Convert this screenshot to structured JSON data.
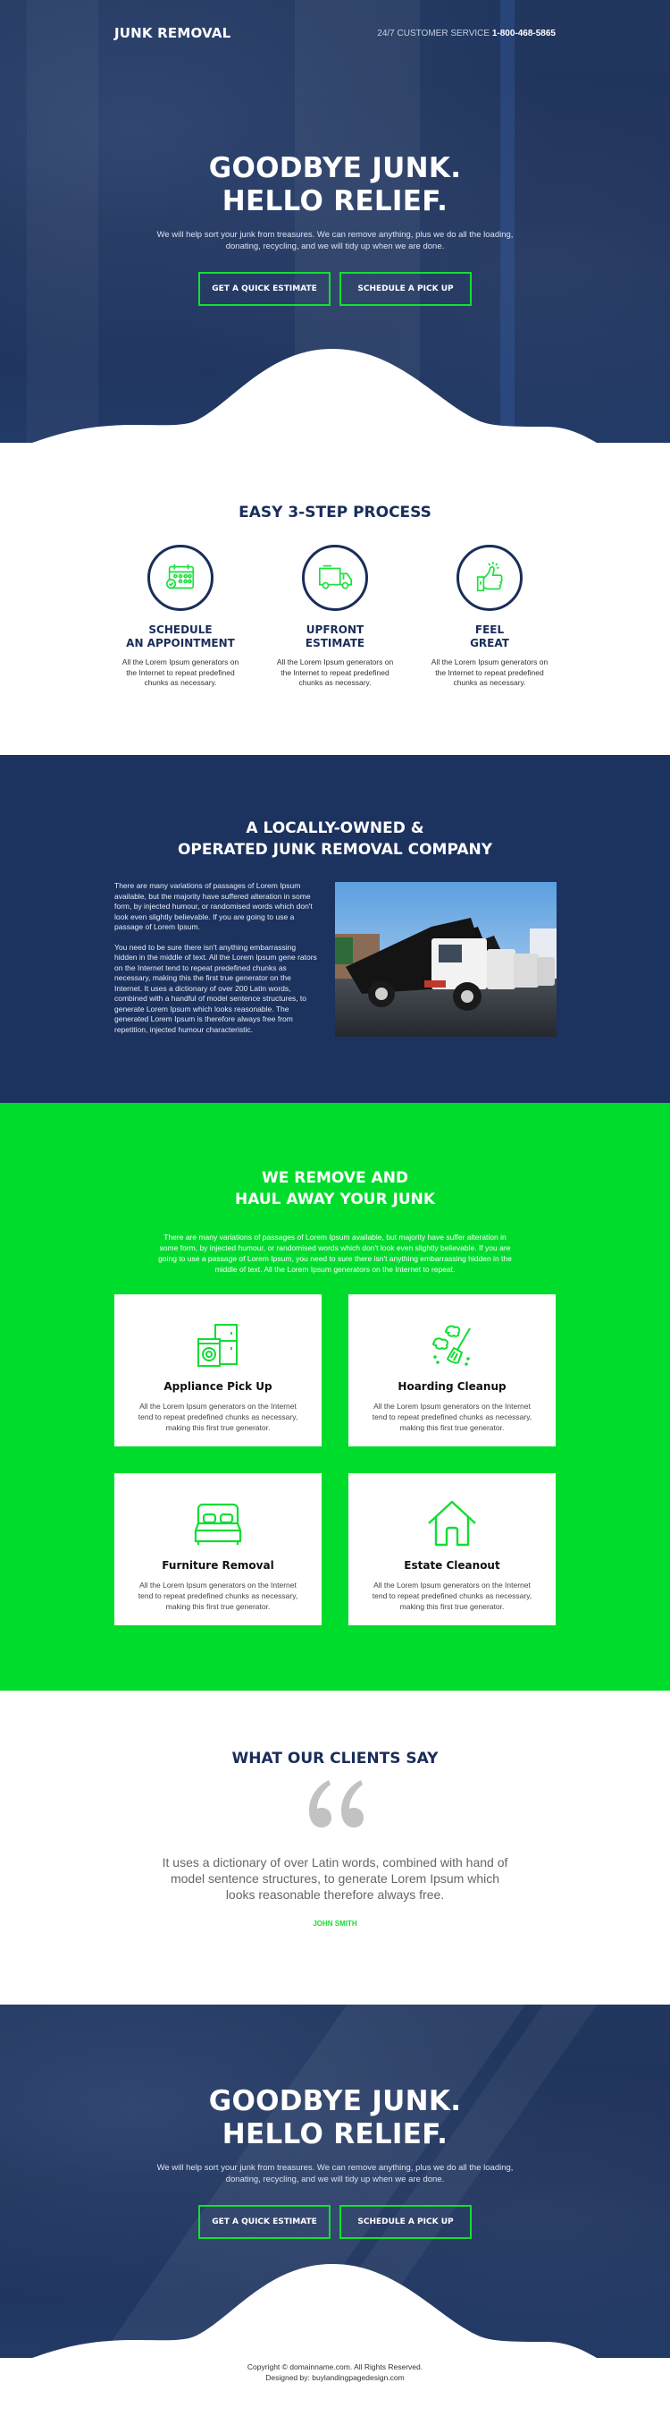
{
  "colors": {
    "navy": "#1c325f",
    "green": "#00dc2c",
    "button_border": "#12e030",
    "title_navy": "#1a2d5a"
  },
  "header": {
    "logo": "JUNK REMOVAL",
    "service_label": "24/7 CUSTOMER SERVICE",
    "phone": "1-800-468-5865"
  },
  "hero": {
    "title_line1": "GOODBYE JUNK.",
    "title_line2": "HELLO RELIEF.",
    "subtitle": "We will help sort your junk from treasures. We can remove anything, plus we do all the loading, donating, recycling, and we will tidy up when we are done.",
    "buttons": [
      {
        "label": "GET A QUICK ESTIMATE"
      },
      {
        "label": "SCHEDULE A PICK UP"
      }
    ]
  },
  "process": {
    "title": "EASY 3-STEP PROCESS",
    "steps": [
      {
        "icon": "calendar-check-icon",
        "title_line1": "SCHEDULE",
        "title_line2": "AN APPOINTMENT",
        "text": "All the Lorem Ipsum generators on the Internet to repeat predefined chunks as necessary."
      },
      {
        "icon": "truck-icon",
        "title_line1": "UPFRONT",
        "title_line2": "ESTIMATE",
        "text": "All the Lorem Ipsum generators on the Internet to repeat predefined chunks as necessary."
      },
      {
        "icon": "thumbs-up-icon",
        "title_line1": "FEEL",
        "title_line2": "GREAT",
        "text": "All the Lorem Ipsum generators on the Internet to repeat predefined chunks as necessary."
      }
    ]
  },
  "about": {
    "title_line1": "A LOCALLY-OWNED &",
    "title_line2": "OPERATED JUNK REMOVAL COMPANY",
    "paragraph1": "There are many variations of passages of Lorem Ipsum available, but the majority have suffered alteration in some form, by injected humour, or randomised words which don't look even slightly believable. If you are going to use a passage of Lorem Ipsum.",
    "paragraph2": "You need to be sure there isn't anything embarrassing hidden in the middle of text. All the Lorem Ipsum gene rators on the Internet tend to repeat predefined chunks as necessary, making this the first true generator on the Internet. It uses a dictionary of over 200 Latin words, combined with a handful of model sentence structures, to generate Lorem Ipsum which looks reasonable. The generated Lorem Ipsum is therefore always free from repetition, injected humour characteristic.",
    "image_alt": "dump-trucks-photo"
  },
  "services": {
    "title_line1": "WE REMOVE AND",
    "title_line2": "HAUL AWAY YOUR JUNK",
    "intro": "There are many variations of passages of Lorem Ipsum available, but majority have suffer alteration in some form, by injected humour, or randomised words which don't look even slightly believable. If you are going to use a passage of Lorem Ipsum, you need to sure there isn't anything embarrassing hidden in the middle of text. All the Lorem Ipsum generators on the Internet to repeat.",
    "cards": [
      {
        "icon": "appliance-icon",
        "title": "Appliance Pick Up",
        "text": "All the Lorem Ipsum generators on the Internet tend to repeat predefined chunks as necessary, making this first true generator."
      },
      {
        "icon": "broom-icon",
        "title": "Hoarding Cleanup",
        "text": "All the Lorem Ipsum generators on the Internet tend to repeat predefined chunks as necessary, making this first true generator."
      },
      {
        "icon": "bed-icon",
        "title": "Furniture Removal",
        "text": "All the Lorem Ipsum generators on the Internet tend to repeat predefined chunks as necessary, making this first true generator."
      },
      {
        "icon": "house-icon",
        "title": "Estate Cleanout",
        "text": "All the Lorem Ipsum generators on the Internet tend to repeat predefined chunks as necessary, making this first true generator."
      }
    ]
  },
  "testimonials": {
    "title": "WHAT OUR CLIENTS SAY",
    "quote_icon": "quote-icon",
    "quote": "It uses a dictionary of over Latin words, combined with hand of model sentence structures, to generate Lorem Ipsum which looks reasonable therefore always free.",
    "author": "JOHN SMITH"
  },
  "footer": {
    "copyright": "Copyright © domainname.com. All Rights Reserved.",
    "designed_by": "Designed by: buylandingpagedesign.com"
  }
}
